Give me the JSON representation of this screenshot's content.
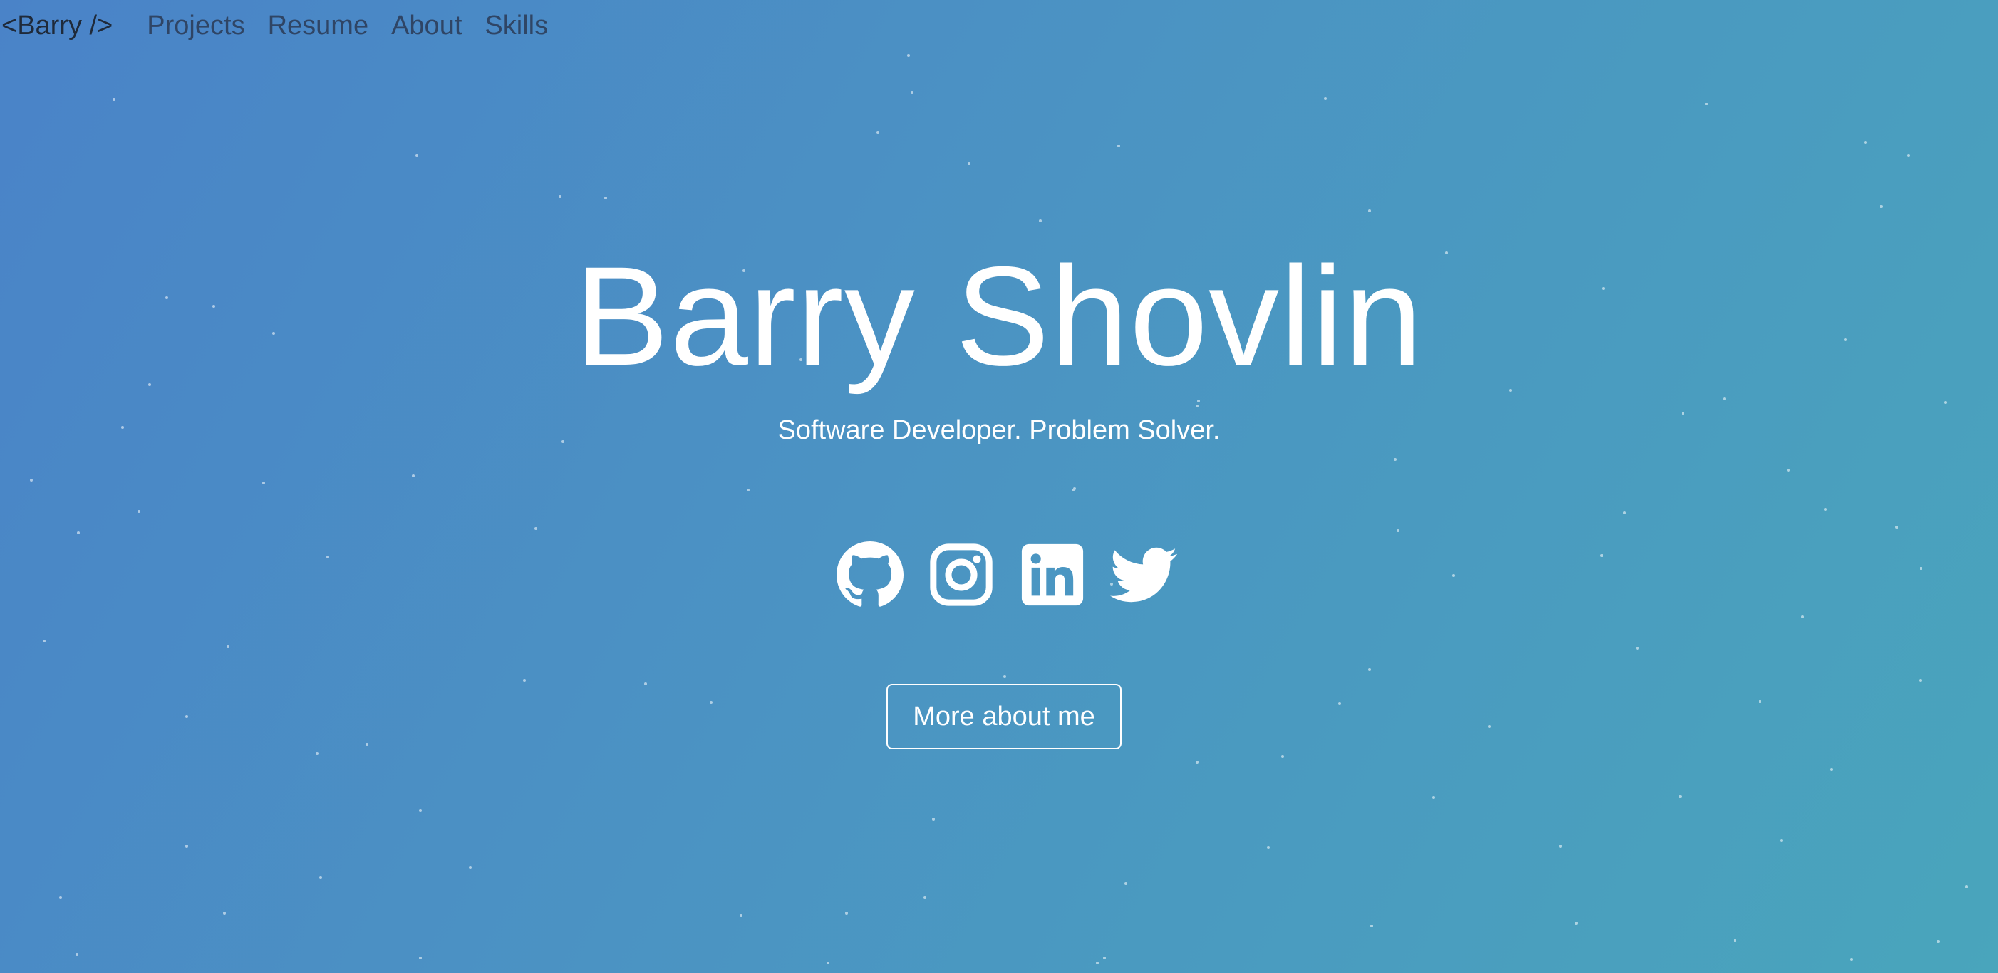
{
  "nav": {
    "brand": "<Barry />",
    "links": [
      "Projects",
      "Resume",
      "About",
      "Skills"
    ]
  },
  "hero": {
    "title": "Barry Shovlin",
    "subtitle": "Software Developer. Problem Solver."
  },
  "social": {
    "icons": [
      "github-icon",
      "instagram-icon",
      "linkedin-icon",
      "twitter-icon"
    ]
  },
  "cta": {
    "label": "More about me"
  },
  "colors": {
    "background_start": "#4a83c8",
    "background_end": "#49a5bc",
    "text": "#ffffff",
    "nav_text": "#2b3a55"
  }
}
